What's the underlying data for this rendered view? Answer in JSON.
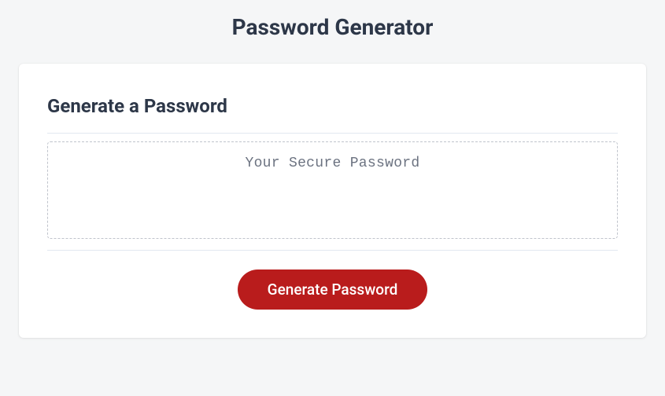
{
  "page": {
    "title": "Password Generator"
  },
  "card": {
    "heading": "Generate a Password",
    "password_placeholder": "Your Secure Password",
    "password_value": "",
    "generate_button_label": "Generate Password"
  },
  "colors": {
    "accent": "#b91c1c",
    "text_dark": "#2d3748",
    "text_muted": "#6b7280",
    "page_bg": "#f5f6f7",
    "card_bg": "#ffffff",
    "border": "#e2e8f0",
    "dashed_border": "#c0c4cc"
  }
}
